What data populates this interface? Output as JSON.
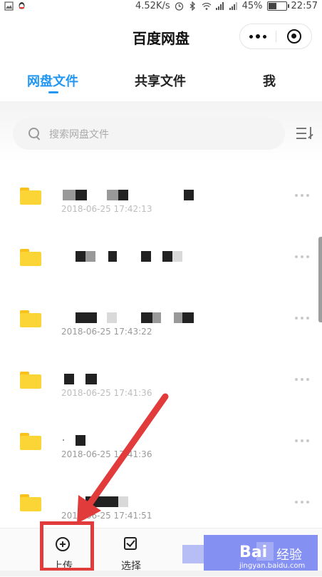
{
  "status_bar": {
    "network_speed": "4.52K/s",
    "battery_percent": "45%",
    "battery_level": 0.45,
    "time": "22:57"
  },
  "header": {
    "title": "百度网盘"
  },
  "tabs": [
    {
      "label": "网盘文件",
      "active": true
    },
    {
      "label": "共享文件",
      "active": false
    },
    {
      "label": "我",
      "active": false
    }
  ],
  "search": {
    "placeholder": "搜索网盘文件"
  },
  "files": [
    {
      "name": "[redacted]",
      "date": "2018-06-25 17:42:13"
    },
    {
      "name": "[redacted]",
      "date": ""
    },
    {
      "name": "[redacted]",
      "date": "2018-06-25 17:43:22"
    },
    {
      "name": "[redacted]",
      "date": "2018-06-25 17:41:36"
    },
    {
      "name": "[redacted]",
      "date": "2018-06-25 17:41:36"
    },
    {
      "name": "[redacted]",
      "date": "2018-06-25 17:41:51"
    }
  ],
  "bottom_bar": {
    "upload_label": "上传",
    "select_label": "选择"
  },
  "watermark": {
    "brand": "Bai",
    "jingyan": "经验",
    "url": "jingyan.baidu.com"
  },
  "colors": {
    "accent": "#2196f3",
    "folder": "#fbd436",
    "annotation_red": "#e23b3b"
  }
}
